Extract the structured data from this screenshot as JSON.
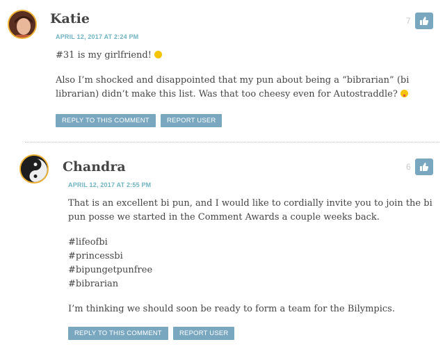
{
  "comments": [
    {
      "author": "Katie",
      "date": "APRIL 12, 2017 AT 2:24 PM",
      "votes": "7",
      "paragraphs": [
        "#31 is my girlfriend!",
        "Also I’m shocked and disappointed that my pun about being a “bibrarian” (bi librarian) didn’t make this list. Was that too cheesy even for Autostraddle?"
      ],
      "reply_label": "REPLY TO THIS COMMENT",
      "report_label": "REPORT USER"
    },
    {
      "author": "Chandra",
      "date": "APRIL 12, 2017 AT 2:55 PM",
      "votes": "6",
      "paragraphs": [
        "That is an excellent bi pun, and I would like to cordially invite you to join the bi pun posse we started in the Comment Awards a couple weeks back.",
        "#lifeofbi",
        "#princessbi",
        "#bipungetpunfree",
        "#bibrarian",
        "I’m thinking we should soon be ready to form a team for the Bilympics."
      ],
      "reply_label": "REPLY TO THIS COMMENT",
      "report_label": "REPORT USER"
    }
  ],
  "icons": {
    "like": "thumbs-up-icon",
    "smile": "smile-emoji-icon",
    "tongue": "tongue-emoji-icon"
  },
  "colors": {
    "accent": "#7aa7c0",
    "date": "#6fb3c3",
    "avatar_border": "#f0b232"
  }
}
